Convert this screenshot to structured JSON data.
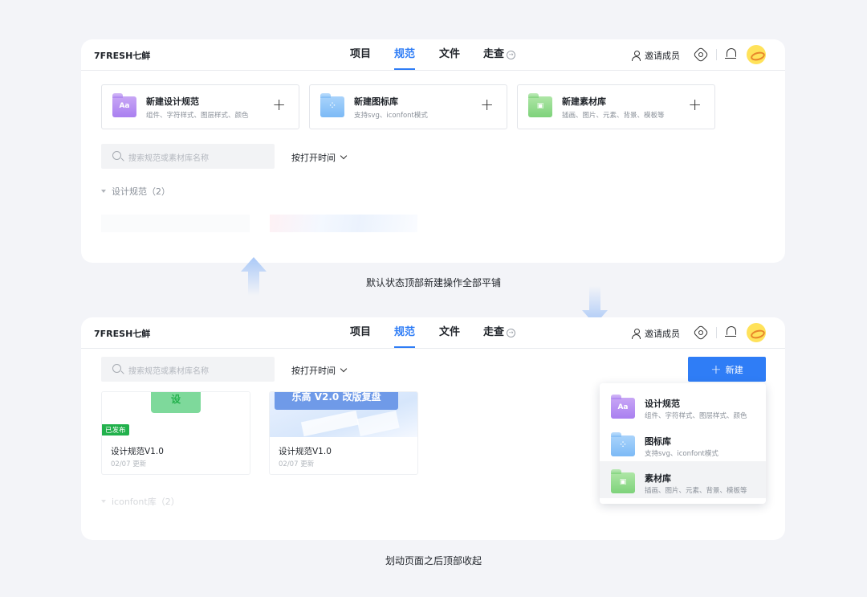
{
  "top_panel": {
    "brand": "7FRESH七鲜",
    "nav": [
      {
        "label": "项目",
        "active": false
      },
      {
        "label": "规范",
        "active": true
      },
      {
        "label": "文件",
        "active": false
      },
      {
        "label": "走查",
        "active": false
      }
    ],
    "invite_label": "邀请成员",
    "cards": [
      {
        "title": "新建设计规范",
        "subtitle": "组件、字符样式、图层样式、颜色",
        "icon": "Aa"
      },
      {
        "title": "新建图标库",
        "subtitle": "支持svg、iconfont模式",
        "icon": "grid"
      },
      {
        "title": "新建素材库",
        "subtitle": "插画、图片、元素、背景、模板等",
        "icon": "image"
      }
    ],
    "search_placeholder": "搜索规范或素材库名称",
    "sort_label": "按打开时间",
    "section_label": "设计规范（2）"
  },
  "caption_top": "默认状态顶部新建操作全部平铺",
  "bottom_panel": {
    "brand": "7FRESH七鲜",
    "nav": [
      {
        "label": "项目",
        "active": false
      },
      {
        "label": "规范",
        "active": true
      },
      {
        "label": "文件",
        "active": false
      },
      {
        "label": "走查",
        "active": false
      }
    ],
    "invite_label": "邀请成员",
    "search_placeholder": "搜索规范或素材库名称",
    "sort_label": "按打开时间",
    "new_button_label": "新建",
    "docs": [
      {
        "title": "设计规范V1.0",
        "date": "02/07 更新",
        "badge": "已发布",
        "thumb_text": "设"
      },
      {
        "title": "设计规范V1.0",
        "date": "02/07 更新",
        "badge": "",
        "thumb_text": "乐高 V2.0 改版复盘"
      }
    ],
    "section_label": "iconfont库（2）",
    "dropdown": [
      {
        "title": "设计规范",
        "subtitle": "组件、字符样式、图层样式、颜色"
      },
      {
        "title": "图标库",
        "subtitle": "支持svg、iconfont模式"
      },
      {
        "title": "素材库",
        "subtitle": "插画、图片、元素、背景、模板等",
        "hovered": true
      }
    ]
  },
  "caption_bottom": "划动页面之后顶部收起",
  "colors": {
    "accent": "#2f7df6",
    "published": "#22b14c",
    "avatar": "#ffe25a"
  }
}
